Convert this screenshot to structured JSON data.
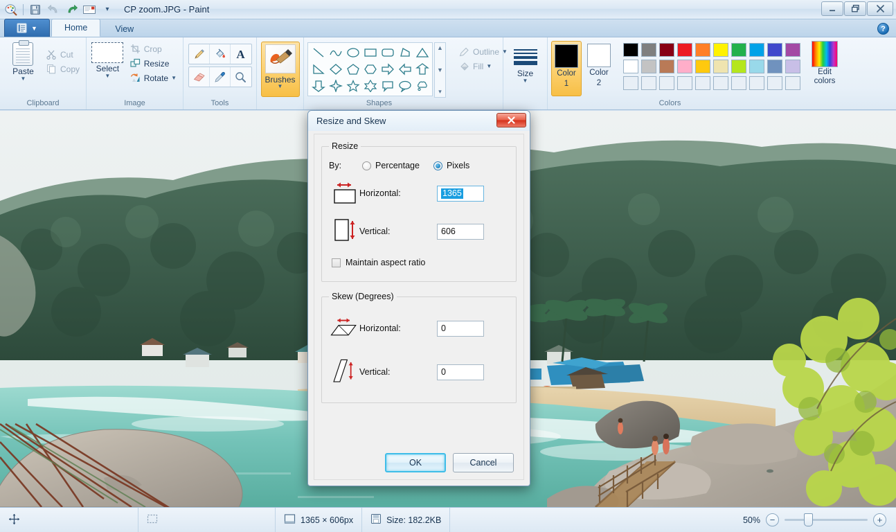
{
  "window": {
    "title": "CP zoom.JPG - Paint",
    "app_icon": "paint-icon",
    "minimize_label": "—",
    "restore_label": "❐",
    "close_label": "✕"
  },
  "quick_access": [
    {
      "name": "save-icon",
      "label": "Save"
    },
    {
      "name": "undo-icon",
      "label": "Undo"
    },
    {
      "name": "redo-icon",
      "label": "Redo"
    },
    {
      "name": "email-icon",
      "label": "Send in e-mail"
    },
    {
      "name": "chevron-down-icon",
      "label": "▾"
    }
  ],
  "tabs": {
    "file_menu_label": "",
    "items": [
      {
        "label": "Home",
        "active": true
      },
      {
        "label": "View",
        "active": false
      }
    ],
    "help_label": "?"
  },
  "ribbon": {
    "groups": [
      {
        "label": "Clipboard",
        "paste_label": "Paste",
        "cut_label": "Cut",
        "copy_label": "Copy"
      },
      {
        "label": "Image",
        "select_label": "Select",
        "crop_label": "Crop",
        "resize_label": "Resize",
        "rotate_label": "Rotate"
      },
      {
        "label": "Tools",
        "tools": [
          "pencil-icon",
          "fill-bucket-icon",
          "text-icon",
          "eraser-icon",
          "color-picker-icon",
          "magnifier-icon"
        ]
      },
      {
        "label": "Brushes",
        "brushes_label": "Brushes"
      },
      {
        "label": "Shapes",
        "outline_label": "Outline",
        "fill_label": "Fill",
        "shapes": [
          "line",
          "curve",
          "oval",
          "rectangle",
          "rounded-rectangle",
          "polygon",
          "triangle",
          "right-triangle",
          "diamond",
          "pentagon",
          "hexagon",
          "right-arrow",
          "left-arrow",
          "up-arrow",
          "down-arrow",
          "four-point-star",
          "five-point-star",
          "six-point-star",
          "rounded-callout",
          "oval-callout",
          "cloud-callout"
        ]
      },
      {
        "label": "Size",
        "size_label": "Size"
      },
      {
        "label": "Colors",
        "color1_label_line1": "Color",
        "color1_label_line2": "1",
        "color2_label_line1": "Color",
        "color2_label_line2": "2",
        "color1_value": "#000000",
        "color2_value": "#ffffff",
        "edit_colors_line1": "Edit",
        "edit_colors_line2": "colors",
        "palette_row1": [
          "#000000",
          "#7f7f7f",
          "#880015",
          "#ed1c24",
          "#ff7f27",
          "#fff200",
          "#22b14c",
          "#00a2e8",
          "#3f48cc",
          "#a349a4"
        ],
        "palette_row2": [
          "#ffffff",
          "#c3c3c3",
          "#b97a57",
          "#ffaec9",
          "#ffc90e",
          "#efe4b0",
          "#b5e61d",
          "#99d9ea",
          "#7092be",
          "#c8bfe7"
        ],
        "palette_row3": [
          "",
          "",
          "",
          "",
          "",
          "",
          "",
          "",
          "",
          ""
        ]
      }
    ]
  },
  "dialog": {
    "title": "Resize and Skew",
    "close_label": "✕",
    "resize": {
      "legend": "Resize",
      "by_label": "By:",
      "percentage_label": "Percentage",
      "percentage_selected": false,
      "pixels_label": "Pixels",
      "pixels_selected": true,
      "horizontal_label": "Horizontal:",
      "horizontal_value": "1365",
      "horizontal_selected": true,
      "vertical_label": "Vertical:",
      "vertical_value": "606",
      "maintain_label": "Maintain aspect ratio",
      "maintain_checked": false
    },
    "skew": {
      "legend": "Skew (Degrees)",
      "horizontal_label": "Horizontal:",
      "horizontal_value": "0",
      "vertical_label": "Vertical:",
      "vertical_value": "0"
    },
    "ok_label": "OK",
    "cancel_label": "Cancel"
  },
  "statusbar": {
    "cursor_icon": "move-cursor-icon",
    "selection_icon": "selection-icon",
    "image_size_icon": "image-size-icon",
    "image_size": "1365 × 606px",
    "file_size_icon": "save-icon",
    "file_size": "Size: 182.2KB",
    "zoom_level": "50%",
    "zoom_out_label": "−",
    "zoom_in_label": "+"
  },
  "colors": {
    "accent": "#f7bf46",
    "ribbon_bg": "#eaf2f9",
    "dialog_bg": "#f0f0f0",
    "selection_blue": "#1a9ee0"
  }
}
